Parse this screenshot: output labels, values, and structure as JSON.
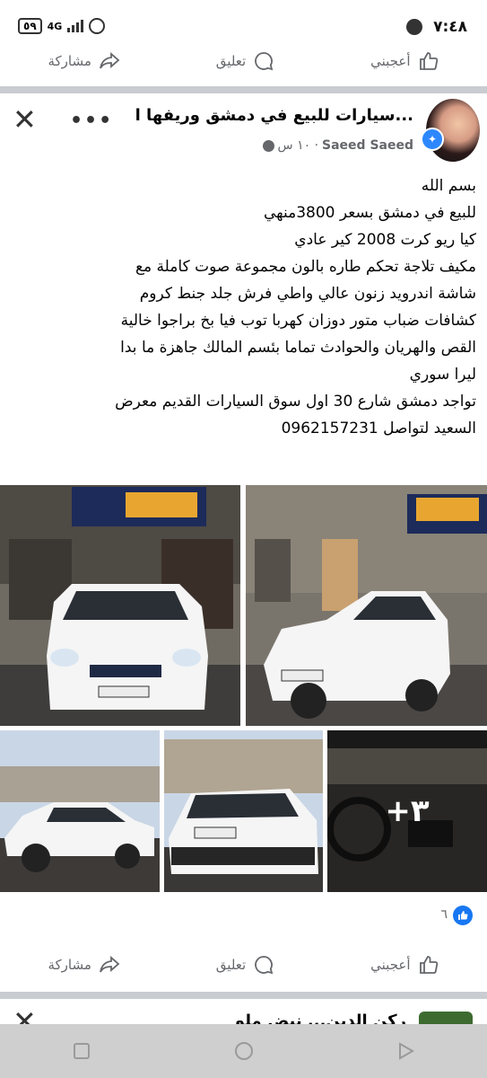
{
  "status": {
    "time": "٧:٤٨",
    "battery": "٥٩",
    "network": "4G"
  },
  "actions": {
    "like": "أعجبني",
    "comment": "تعليق",
    "share": "مشاركة"
  },
  "post": {
    "title": "سيارات للبيع في دمشق وريفها ا...",
    "author": "Saeed Saeed",
    "time": "١٠ س ·",
    "body_lines": [
      "بسم الله",
      "للبيع في دمشق          بسعر 3800منهي",
      "كيا ريو كرت 2008 كير عادي",
      "مكيف تلاجة تحكم طاره بالون مجموعة صوت كاملة مع",
      "شاشة اندرويد زنون عالي واطي فرش جلد جنط كروم",
      "كشافات ضباب متور دوزان كهربا توب فيا بخ براجوا خالية",
      "القص والهريان والحوادث  تماما بئسم المالك جاهزة ما بدا",
      "ليرا سوري",
      "تواجد دمشق شارع 30 اول سوق السيارات القديم معرض",
      "السعيد لتواصل 0962157231"
    ],
    "more_photos": "+٣",
    "reaction_count": "٦"
  },
  "next_post": {
    "title": "ركن الدين... نبض ملو"
  },
  "colors": {
    "facebook_blue": "#1877f2",
    "separator": "#c9ccd1",
    "secondary_text": "#65676b"
  }
}
